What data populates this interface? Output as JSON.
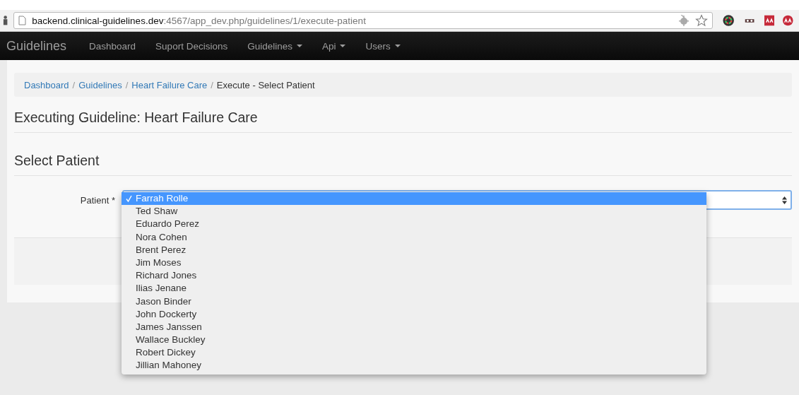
{
  "browser": {
    "url_host": "backend.clinical-guidelines.dev",
    "url_path": ":4567/app_dev.php/guidelines/1/execute-patient"
  },
  "navbar": {
    "brand": "Guidelines",
    "items": [
      {
        "label": "Dashboard",
        "has_menu": false
      },
      {
        "label": "Suport Decisions",
        "has_menu": false
      },
      {
        "label": "Guidelines",
        "has_menu": true
      },
      {
        "label": "Api",
        "has_menu": true
      },
      {
        "label": "Users",
        "has_menu": true
      }
    ]
  },
  "breadcrumb_separator": "/",
  "breadcrumb": [
    {
      "label": "Dashboard",
      "link": true
    },
    {
      "label": "Guidelines",
      "link": true
    },
    {
      "label": "Heart Failure Care",
      "link": true
    },
    {
      "label": "Execute - Select Patient",
      "link": false
    }
  ],
  "page_title": "Executing Guideline: Heart Failure Care",
  "section_title": "Select Patient",
  "form": {
    "label": "Patient *",
    "options": [
      {
        "label": "Farrah Rolle",
        "selected": true
      },
      {
        "label": "Ted Shaw",
        "selected": false
      },
      {
        "label": "Eduardo Perez",
        "selected": false
      },
      {
        "label": "Nora Cohen",
        "selected": false
      },
      {
        "label": "Brent Perez",
        "selected": false
      },
      {
        "label": "Jim Moses",
        "selected": false
      },
      {
        "label": "Richard Jones",
        "selected": false
      },
      {
        "label": "Ilias Jenane",
        "selected": false
      },
      {
        "label": "Jason Binder",
        "selected": false
      },
      {
        "label": "John Dockerty",
        "selected": false
      },
      {
        "label": "James Janssen",
        "selected": false
      },
      {
        "label": "Wallace Buckley",
        "selected": false
      },
      {
        "label": "Robert Dickey",
        "selected": false
      },
      {
        "label": "Jillian Mahoney",
        "selected": false
      }
    ]
  }
}
